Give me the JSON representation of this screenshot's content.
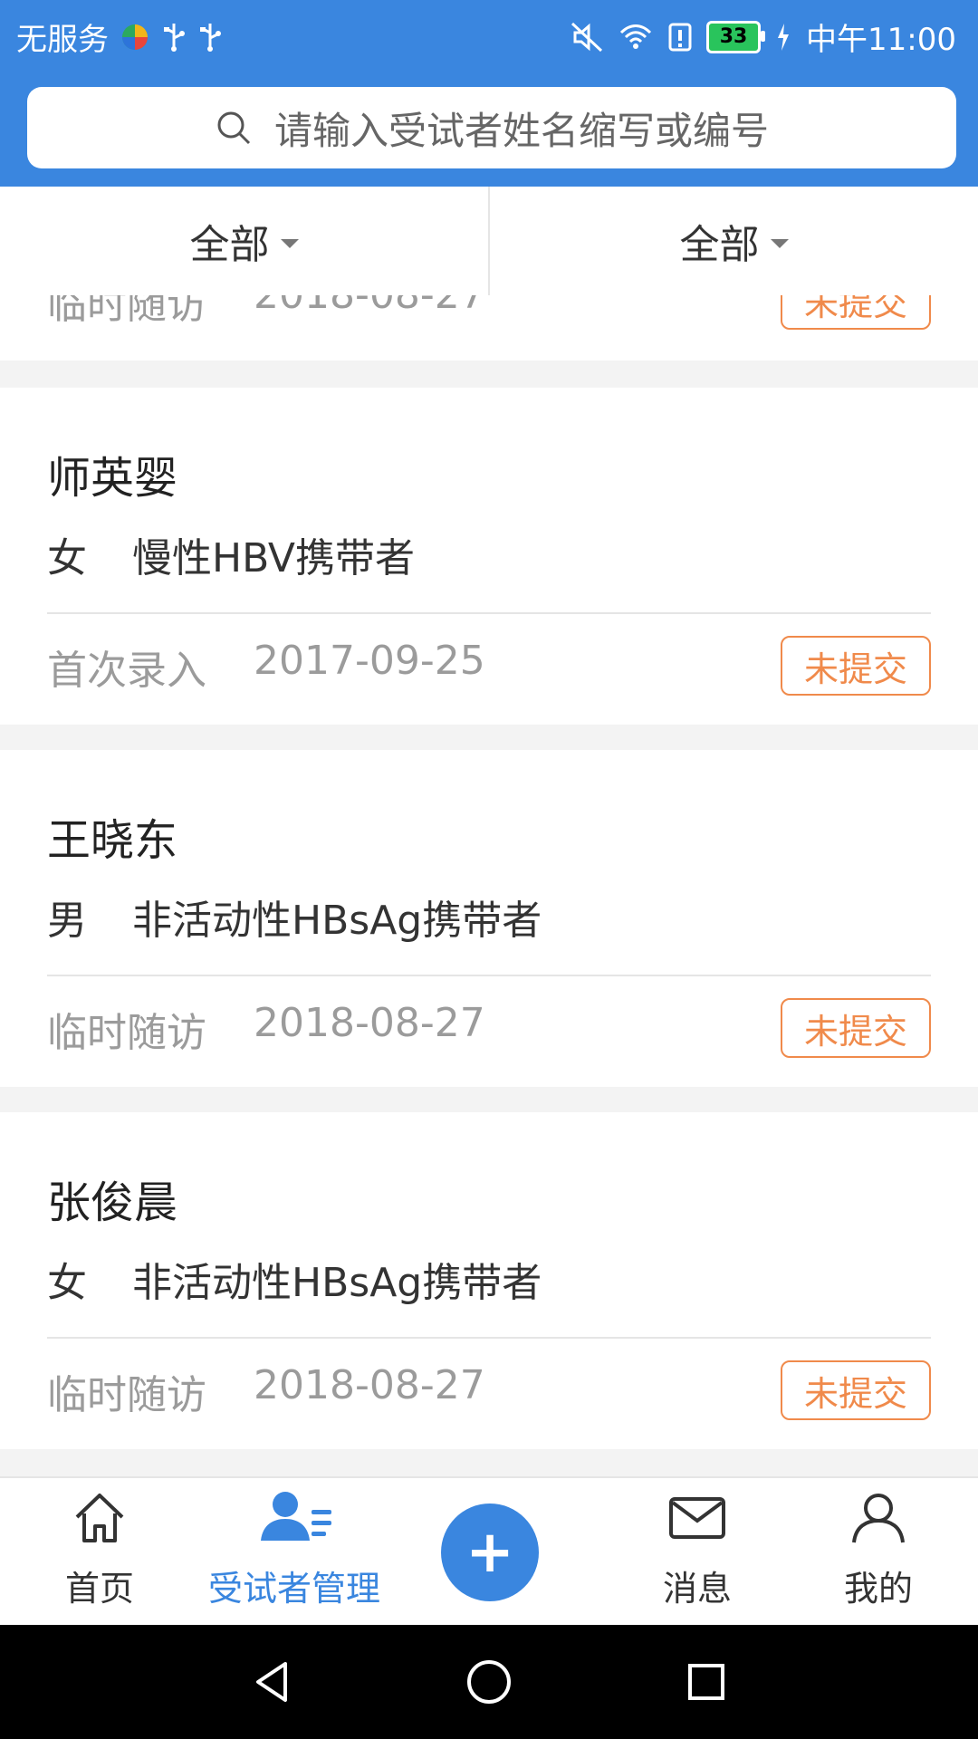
{
  "status": {
    "left_text": "无服务",
    "time": "中午11:00",
    "battery": "33",
    "icons": [
      "colorful-app-icon",
      "usb-icon",
      "usb-icon",
      "mute-icon",
      "wifi-icon",
      "alert-icon",
      "battery-icon",
      "charging-icon"
    ]
  },
  "header": {
    "search_placeholder": "请输入受试者姓名缩写或编号",
    "search_icon": "search-icon"
  },
  "filters": [
    {
      "label": "全部"
    },
    {
      "label": "全部"
    }
  ],
  "records": [
    {
      "visit_type": "临时随访",
      "date": "2018-08-27",
      "status": "未提交",
      "partial": true
    },
    {
      "name": "师英婴",
      "gender": "女",
      "diagnosis": "慢性HBV携带者",
      "visit_type": "首次录入",
      "date": "2017-09-25",
      "status": "未提交"
    },
    {
      "name": "王晓东",
      "gender": "男",
      "diagnosis": "非活动性HBsAg携带者",
      "visit_type": "临时随访",
      "date": "2018-08-27",
      "status": "未提交"
    },
    {
      "name": "张俊晨",
      "gender": "女",
      "diagnosis": "非活动性HBsAg携带者",
      "visit_type": "临时随访",
      "date": "2018-08-27",
      "status": "未提交"
    }
  ],
  "bottom_nav": {
    "items": [
      {
        "label": "首页",
        "icon": "home-icon"
      },
      {
        "label": "受试者管理",
        "icon": "subjects-icon",
        "active": true
      },
      {
        "label": "",
        "icon": "plus-icon"
      },
      {
        "label": "消息",
        "icon": "mail-icon"
      },
      {
        "label": "我的",
        "icon": "user-icon"
      }
    ]
  },
  "colors": {
    "primary": "#3a86df",
    "badge": "#f08a4b"
  }
}
